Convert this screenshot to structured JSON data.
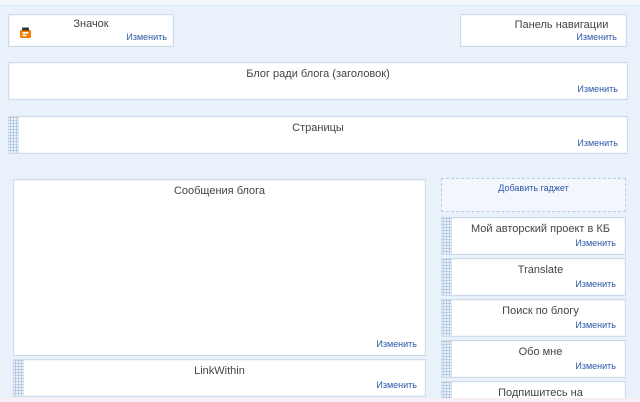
{
  "edit_label": "Изменить",
  "favicon_widget": {
    "title": "Значок",
    "icon": "blogger-favicon"
  },
  "navbar_widget": {
    "title": "Панель навигации"
  },
  "header_widget": {
    "title": "Блог ради блога (заголовок)"
  },
  "pages_widget": {
    "title": "Страницы"
  },
  "posts_widget": {
    "title": "Сообщения блога"
  },
  "linkwithin_widget": {
    "title": "LinkWithin"
  },
  "sidebar": {
    "add_gadget": "Добавить гаджет",
    "gadgets": [
      {
        "title": "Мой авторский проект в КБ"
      },
      {
        "title": "Translate"
      },
      {
        "title": "Поиск по блогу"
      },
      {
        "title": "Обо мне"
      },
      {
        "title": "Подпишитесь на"
      }
    ]
  },
  "colors": {
    "link": "#2a58a8",
    "background": "#e9f1fb",
    "border": "#cfdbe8",
    "accent": "#f57c00"
  }
}
